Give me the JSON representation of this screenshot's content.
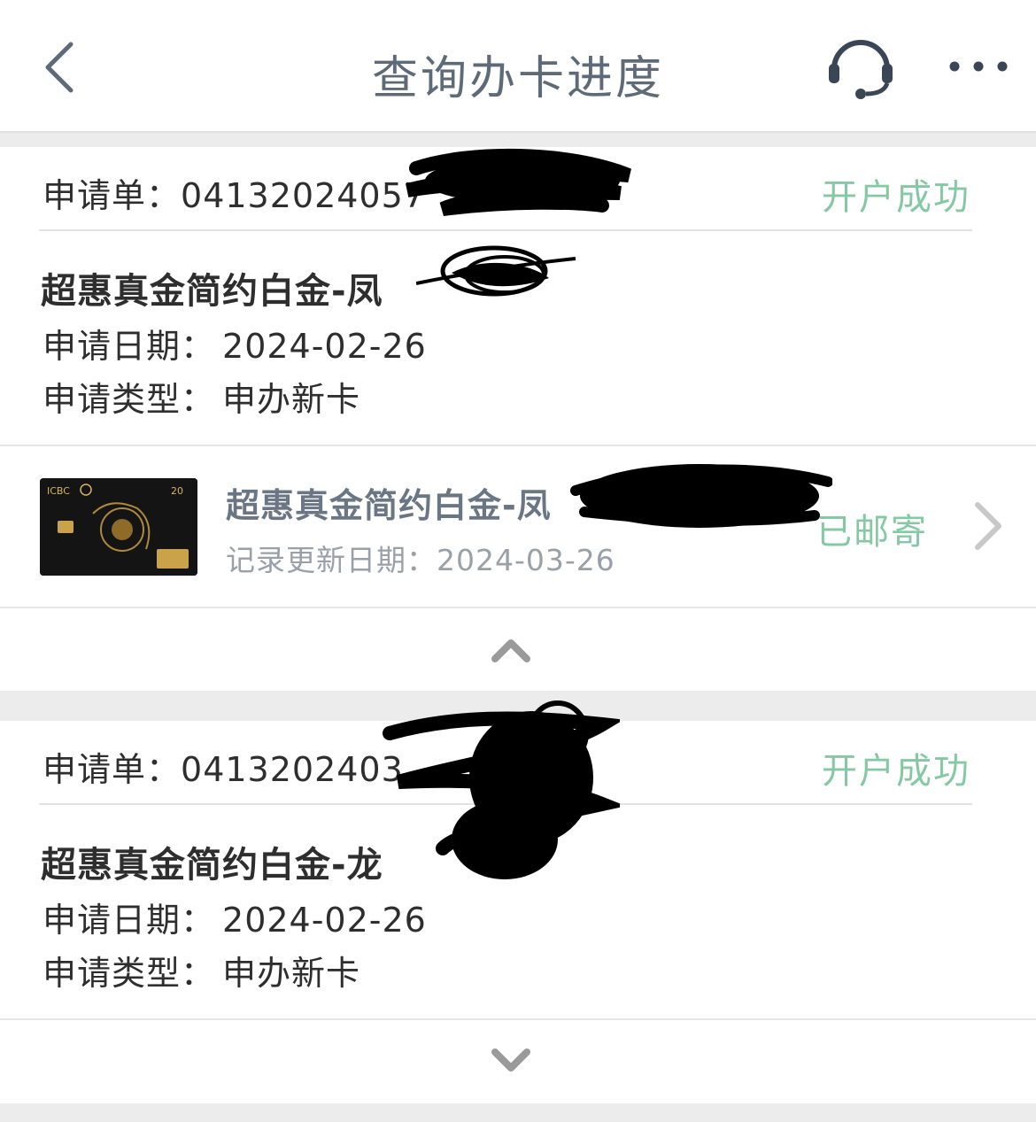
{
  "header": {
    "title": "查询办卡进度",
    "back_icon": "back-arrow-icon",
    "service_icon": "headset-icon",
    "more_icon": "more-dots-icon"
  },
  "applications": [
    {
      "app_no_label": "申请单：",
      "app_no": "04132024057",
      "status": "开户成功",
      "product": "超惠真金简约白金-凤",
      "apply_date_label": "申请日期：",
      "apply_date": "2024-02-26",
      "apply_type_label": "申请类型：",
      "apply_type": "申办新卡",
      "card_item": {
        "title": "超惠真金简约白金-凤",
        "updated_label": "记录更新日期：",
        "updated_date": "2024-03-26",
        "status": "已邮寄",
        "image": "icbc-black-card-image"
      },
      "toggle_icon": "chevron-up-icon"
    },
    {
      "app_no_label": "申请单：",
      "app_no": "0413202403",
      "status": "开户成功",
      "product": "超惠真金简约白金-龙",
      "apply_date_label": "申请日期：",
      "apply_date": "2024-02-26",
      "apply_type_label": "申请类型：",
      "apply_type": "申办新卡",
      "toggle_icon": "chevron-down-icon"
    }
  ],
  "colors": {
    "status_green": "#84c9a3",
    "title_gray": "#5e6a78",
    "background": "#ececec"
  }
}
